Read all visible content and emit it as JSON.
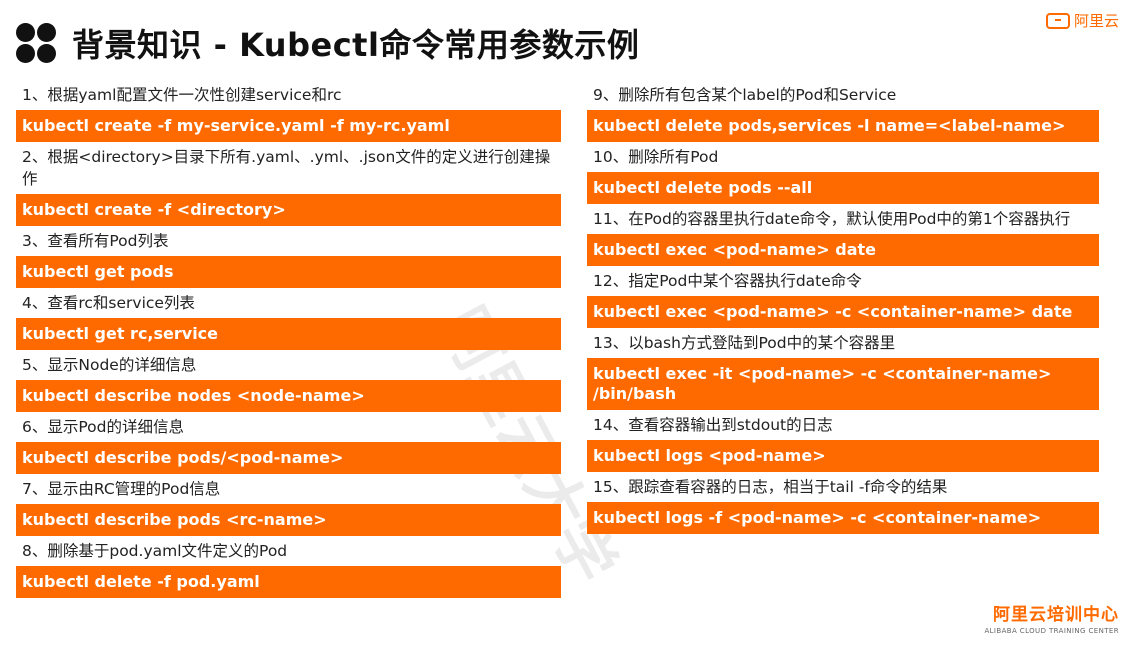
{
  "title": "背景知识 - Kubectl命令常用参数示例",
  "brand_top": "阿里云",
  "watermark": "阿里云大学",
  "footer": {
    "cn": "阿里云培训中心",
    "en": "ALIBABA CLOUD TRAINING CENTER"
  },
  "left": [
    {
      "desc": "1、根据yaml配置文件一次性创建service和rc",
      "cmd": "kubectl create -f my-service.yaml -f my-rc.yaml"
    },
    {
      "desc": "2、根据<directory>目录下所有.yaml、.yml、.json文件的定义进行创建操作",
      "cmd": "kubectl create -f <directory>"
    },
    {
      "desc": "3、查看所有Pod列表",
      "cmd": "kubectl get pods"
    },
    {
      "desc": "4、查看rc和service列表",
      "cmd": "kubectl get rc,service"
    },
    {
      "desc": "5、显示Node的详细信息",
      "cmd": "kubectl describe nodes <node-name>"
    },
    {
      "desc": "6、显示Pod的详细信息",
      "cmd": "kubectl describe pods/<pod-name>"
    },
    {
      "desc": "7、显示由RC管理的Pod信息",
      "cmd": "kubectl describe pods <rc-name>"
    },
    {
      "desc": "8、删除基于pod.yaml文件定义的Pod",
      "cmd": "kubectl delete -f pod.yaml"
    }
  ],
  "right": [
    {
      "desc": "9、删除所有包含某个label的Pod和Service",
      "cmd": "kubectl delete pods,services -l name=<label-name>"
    },
    {
      "desc": "10、删除所有Pod",
      "cmd": "kubectl delete pods --all"
    },
    {
      "desc": "11、在Pod的容器里执行date命令，默认使用Pod中的第1个容器执行",
      "cmd": "kubectl exec <pod-name> date"
    },
    {
      "desc": "12、指定Pod中某个容器执行date命令",
      "cmd": "kubectl exec <pod-name> -c <container-name> date"
    },
    {
      "desc": "13、以bash方式登陆到Pod中的某个容器里",
      "cmd": "kubectl exec -it <pod-name> -c <container-name> /bin/bash"
    },
    {
      "desc": "14、查看容器输出到stdout的日志",
      "cmd": "kubectl logs <pod-name>"
    },
    {
      "desc": "15、跟踪查看容器的日志，相当于tail -f命令的结果",
      "cmd": "kubectl logs -f <pod-name> -c <container-name>"
    }
  ]
}
